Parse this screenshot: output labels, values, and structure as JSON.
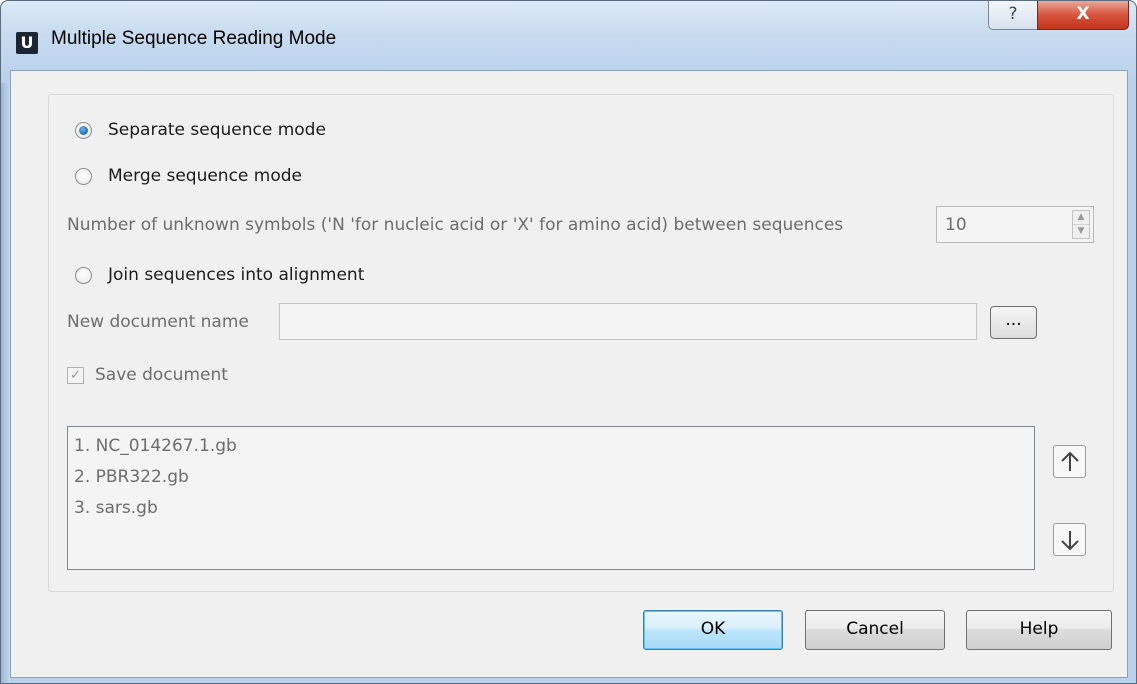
{
  "window": {
    "icon_letter": "U",
    "title": "Multiple Sequence Reading Mode",
    "help_glyph": "?",
    "close_glyph": "X"
  },
  "modes": {
    "separate_label": "Separate sequence mode",
    "merge_label": "Merge sequence mode",
    "join_label": "Join sequences into alignment",
    "selected": "separate"
  },
  "merge_options": {
    "unknown_symbols_label": "Number of unknown symbols ('N 'for nucleic acid or 'X' for amino acid) between sequences",
    "unknown_symbols_value": "10"
  },
  "join_options": {
    "doc_name_label": "New document name",
    "doc_name_value": "",
    "browse_label": "...",
    "save_label": "Save document",
    "save_checked": true
  },
  "files": {
    "items": [
      "1. NC_014267.1.gb",
      "2. PBR322.gb",
      "3. sars.gb"
    ],
    "up_icon": "arrow-up-icon",
    "down_icon": "arrow-down-icon"
  },
  "buttons": {
    "ok_label": "OK",
    "cancel_label": "Cancel",
    "help_label": "Help"
  },
  "colors": {
    "window_frame": "#b9d1ea",
    "client_bg": "#f0f0f0",
    "close_red": "#c2331b",
    "default_button_blue": "#3c7fb1",
    "disabled_text": "#6d6d6d"
  }
}
